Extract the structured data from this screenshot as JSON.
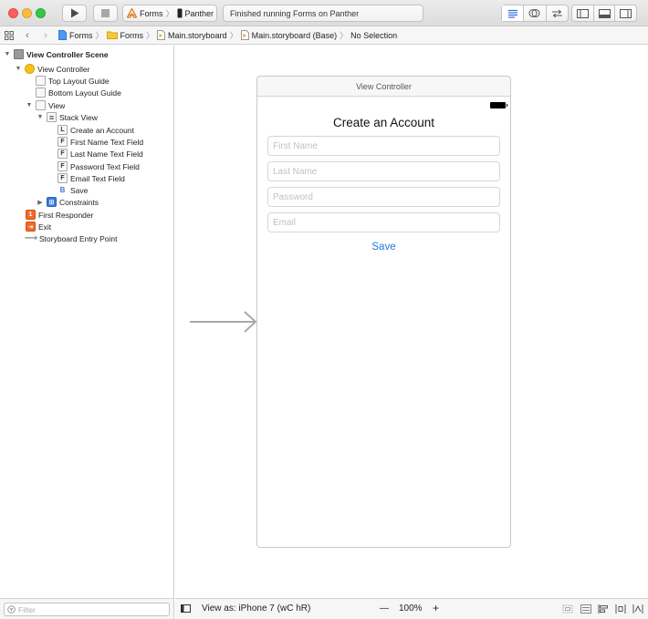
{
  "toolbar": {
    "scheme_target": "Forms",
    "scheme_device": "Panther",
    "activity_status": "Finished running Forms on Panther"
  },
  "jumpbar": {
    "crumbs": [
      "Forms",
      "Forms",
      "Main.storyboard",
      "Main.storyboard (Base)",
      "No Selection"
    ]
  },
  "outline": {
    "items": [
      {
        "label": "View Controller Scene",
        "icon": "scene-icon",
        "glyph": ""
      },
      {
        "label": "View Controller",
        "icon": "view-controller-icon",
        "glyph": ""
      },
      {
        "label": "Top Layout Guide",
        "icon": "layout-guide-icon",
        "glyph": ""
      },
      {
        "label": "Bottom Layout Guide",
        "icon": "layout-guide-icon",
        "glyph": ""
      },
      {
        "label": "View",
        "icon": "view-icon",
        "glyph": ""
      },
      {
        "label": "Stack View",
        "icon": "stack-view-icon",
        "glyph": ""
      },
      {
        "label": "Create an Account",
        "icon": "label-icon",
        "glyph": "L"
      },
      {
        "label": "First Name Text Field",
        "icon": "text-field-icon",
        "glyph": "F"
      },
      {
        "label": "Last Name Text Field",
        "icon": "text-field-icon",
        "glyph": "F"
      },
      {
        "label": "Password Text Field",
        "icon": "text-field-icon",
        "glyph": "F"
      },
      {
        "label": "Email Text Field",
        "icon": "text-field-icon",
        "glyph": "F"
      },
      {
        "label": "Save",
        "icon": "button-icon",
        "glyph": "B"
      },
      {
        "label": "Constraints",
        "icon": "constraints-icon",
        "glyph": ""
      },
      {
        "label": "First Responder",
        "icon": "first-responder-icon",
        "glyph": ""
      },
      {
        "label": "Exit",
        "icon": "exit-icon",
        "glyph": ""
      },
      {
        "label": "Storyboard Entry Point",
        "icon": "entry-point-icon",
        "glyph": ""
      }
    ],
    "filter_placeholder": "Filter"
  },
  "canvas": {
    "scene_title": "View Controller",
    "form": {
      "title": "Create an Account",
      "fields": [
        {
          "placeholder": "First Name",
          "value": ""
        },
        {
          "placeholder": "Last Name",
          "value": ""
        },
        {
          "placeholder": "Password",
          "value": ""
        },
        {
          "placeholder": "Email",
          "value": ""
        }
      ],
      "save_label": "Save"
    }
  },
  "bottom_bar": {
    "view_as": "View as: iPhone 7 (wC hR)",
    "zoom_minus": "—",
    "zoom_level": "100%",
    "zoom_plus": "+"
  },
  "colors": {
    "accent": "#1a7cd9",
    "scheme_icon": "#3b7ad9",
    "traffic_close": "#fc605c",
    "traffic_min": "#fdbc40",
    "traffic_max": "#34c84a"
  }
}
